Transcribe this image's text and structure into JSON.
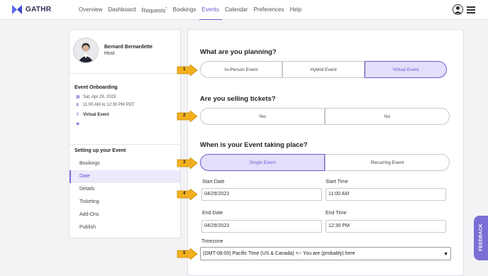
{
  "app": {
    "logo_text": "GATHR",
    "brand_color": "#6a5acd"
  },
  "nav": {
    "items": [
      {
        "label": "Overview"
      },
      {
        "label": "Dashboard"
      },
      {
        "label": "Requests",
        "badge": "*"
      },
      {
        "label": "Bookings"
      },
      {
        "label": "Events",
        "active": true
      },
      {
        "label": "Calendar"
      },
      {
        "label": "Preferences"
      },
      {
        "label": "Help"
      }
    ]
  },
  "profile": {
    "name": "Bernard Bernardette",
    "role": "Host"
  },
  "event": {
    "title": "Event Onboarding",
    "date": "Sat, Apr 29, 2023",
    "time": "11:00 AM to 12:30 PM PDT",
    "type": "Virtual Event"
  },
  "steps": {
    "title": "Setting up your Event",
    "items": [
      {
        "label": "Bookings"
      },
      {
        "label": "Date",
        "active": true
      },
      {
        "label": "Details"
      },
      {
        "label": "Ticketing"
      },
      {
        "label": "Add-Ons"
      },
      {
        "label": "Publish"
      }
    ]
  },
  "form": {
    "q_planning": "What are you planning?",
    "planning_options": [
      "In-Person Event",
      "Hybrid Event",
      "Virtual Event"
    ],
    "planning_selected": "Virtual Event",
    "q_tickets": "Are you selling tickets?",
    "ticket_options": [
      "Yes",
      "No"
    ],
    "q_when": "When is your Event taking place?",
    "when_options": [
      "Single Event",
      "Recurring Event"
    ],
    "when_selected": "Single Event",
    "start_date_label": "Start Date",
    "start_date_value": "04/29/2023",
    "start_time_label": "Start Time",
    "start_time_value": "11:00 AM",
    "end_date_label": "End Date",
    "end_date_value": "04/29/2023",
    "end_time_label": "End Time",
    "end_time_value": "12:30 PM",
    "timezone_label": "Timezone",
    "timezone_value": "(GMT-08:00) Pacific Time (US & Canada) <-- You are (probably) here"
  },
  "markers": [
    "1",
    "2",
    "3",
    "4",
    "5"
  ],
  "marker_color": "#f2b01e",
  "feedback_label": "FEEDBACK"
}
